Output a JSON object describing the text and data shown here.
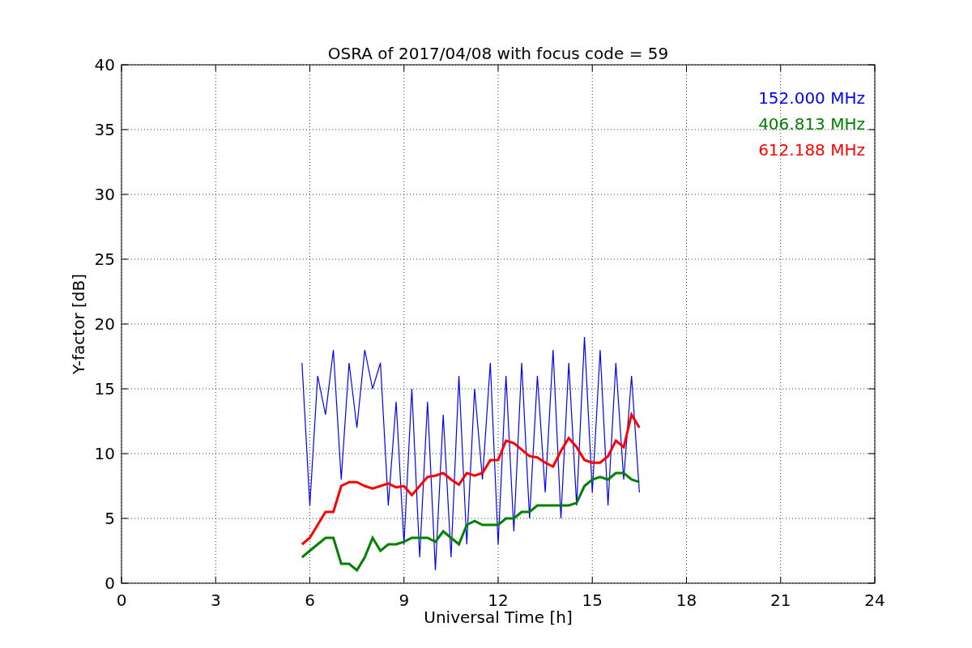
{
  "chart": {
    "chart_data": {
      "type": "line",
      "title": "OSRA of 2017/04/08 with focus code = 59",
      "xlabel": "Universal Time [h]",
      "ylabel": "Y-factor [dB]",
      "xlim": [
        0,
        24
      ],
      "ylim": [
        0,
        40
      ],
      "xticks": [
        0,
        3,
        6,
        9,
        12,
        15,
        18,
        21,
        24
      ],
      "yticks": [
        0,
        5,
        10,
        15,
        20,
        25,
        30,
        35,
        40
      ],
      "grid": true,
      "x": [
        5.75,
        6,
        6.25,
        6.5,
        6.75,
        7,
        7.25,
        7.5,
        7.75,
        8,
        8.25,
        8.5,
        8.75,
        9,
        9.25,
        9.5,
        9.75,
        10,
        10.25,
        10.5,
        10.75,
        11,
        11.25,
        11.5,
        11.75,
        12,
        12.25,
        12.5,
        12.75,
        13,
        13.25,
        13.5,
        13.75,
        14,
        14.25,
        14.5,
        14.75,
        15,
        15.25,
        15.5,
        15.75,
        16,
        16.25,
        16.5
      ],
      "series": [
        {
          "name": "152.000 MHz",
          "color": "#0000ff",
          "values": [
            17,
            6,
            16,
            13,
            18,
            8,
            17,
            12,
            18,
            15,
            17,
            6,
            14,
            3,
            15,
            2,
            14,
            1,
            13,
            2,
            16,
            3,
            15,
            8,
            17,
            3,
            16,
            4,
            17,
            5,
            16,
            7,
            18,
            5,
            17,
            6,
            19,
            7,
            18,
            6,
            17,
            8,
            16,
            7
          ]
        },
        {
          "name": "406.813 MHz",
          "color": "#008000",
          "values": [
            2,
            2.5,
            3,
            3.5,
            3.5,
            1.5,
            1.5,
            1,
            2,
            3.5,
            2.5,
            3,
            3,
            3.2,
            3.5,
            3.5,
            3.5,
            3.2,
            4,
            3.5,
            3,
            4.5,
            4.8,
            4.5,
            4.5,
            4.5,
            5,
            5,
            5.5,
            5.5,
            6,
            6,
            6,
            6,
            6,
            6.2,
            7.5,
            8,
            8.2,
            8,
            8.5,
            8.5,
            8,
            7.8
          ]
        },
        {
          "name": "612.188 MHz",
          "color": "#ff0000",
          "values": [
            3,
            3.5,
            4.5,
            5.5,
            5.5,
            7.5,
            7.8,
            7.8,
            7.5,
            7.3,
            7.5,
            7.7,
            7.4,
            7.5,
            6.8,
            7.5,
            8.2,
            8.3,
            8.5,
            8.0,
            7.6,
            8.5,
            8.3,
            8.5,
            9.5,
            9.5,
            11,
            10.8,
            10.3,
            9.8,
            9.7,
            9.3,
            9.0,
            10.2,
            11.2,
            10.5,
            9.5,
            9.3,
            9.3,
            9.8,
            11,
            10.5,
            13,
            12
          ]
        }
      ]
    }
  }
}
